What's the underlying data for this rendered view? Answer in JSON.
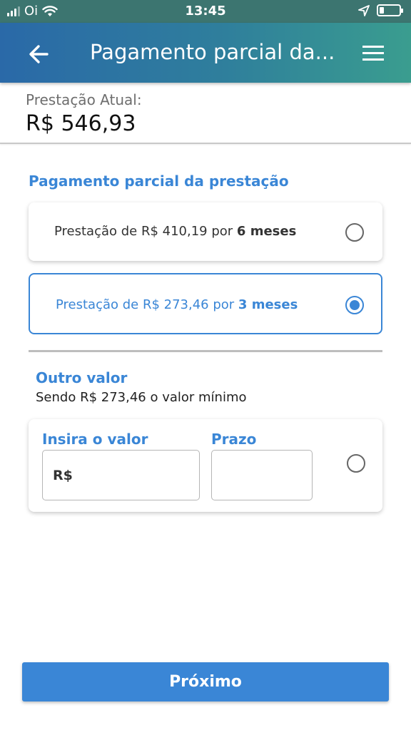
{
  "status_bar": {
    "carrier": "Oi",
    "time": "13:45",
    "icons": [
      "signal-icon",
      "wifi-icon",
      "location-icon",
      "battery-icon"
    ]
  },
  "header": {
    "title": "Pagamento parcial da...",
    "back_icon": "arrow-left-icon",
    "menu_icon": "hamburger-menu-icon",
    "gradient": [
      "#2a69a8",
      "#3a9d8f"
    ]
  },
  "current": {
    "label": "Prestação Atual:",
    "value": "R$ 546,93"
  },
  "partial": {
    "title": "Pagamento parcial da prestação",
    "options": [
      {
        "prefix": "Prestação de R$ 410,19 por ",
        "bold": "6 meses",
        "selected": false
      },
      {
        "prefix": "Prestação de R$ 273,46 por ",
        "bold": "3 meses",
        "selected": true
      }
    ]
  },
  "other": {
    "title": "Outro valor",
    "subtitle": "Sendo R$ 273,46 o valor mínimo",
    "value_label": "Insira o valor",
    "value_prefix": "R$",
    "value_input": "",
    "term_label": "Prazo",
    "term_input": "",
    "selected": false
  },
  "next_button": {
    "label": "Próximo"
  },
  "colors": {
    "accent": "#3a86d6",
    "status_bar": "#3c7570"
  }
}
